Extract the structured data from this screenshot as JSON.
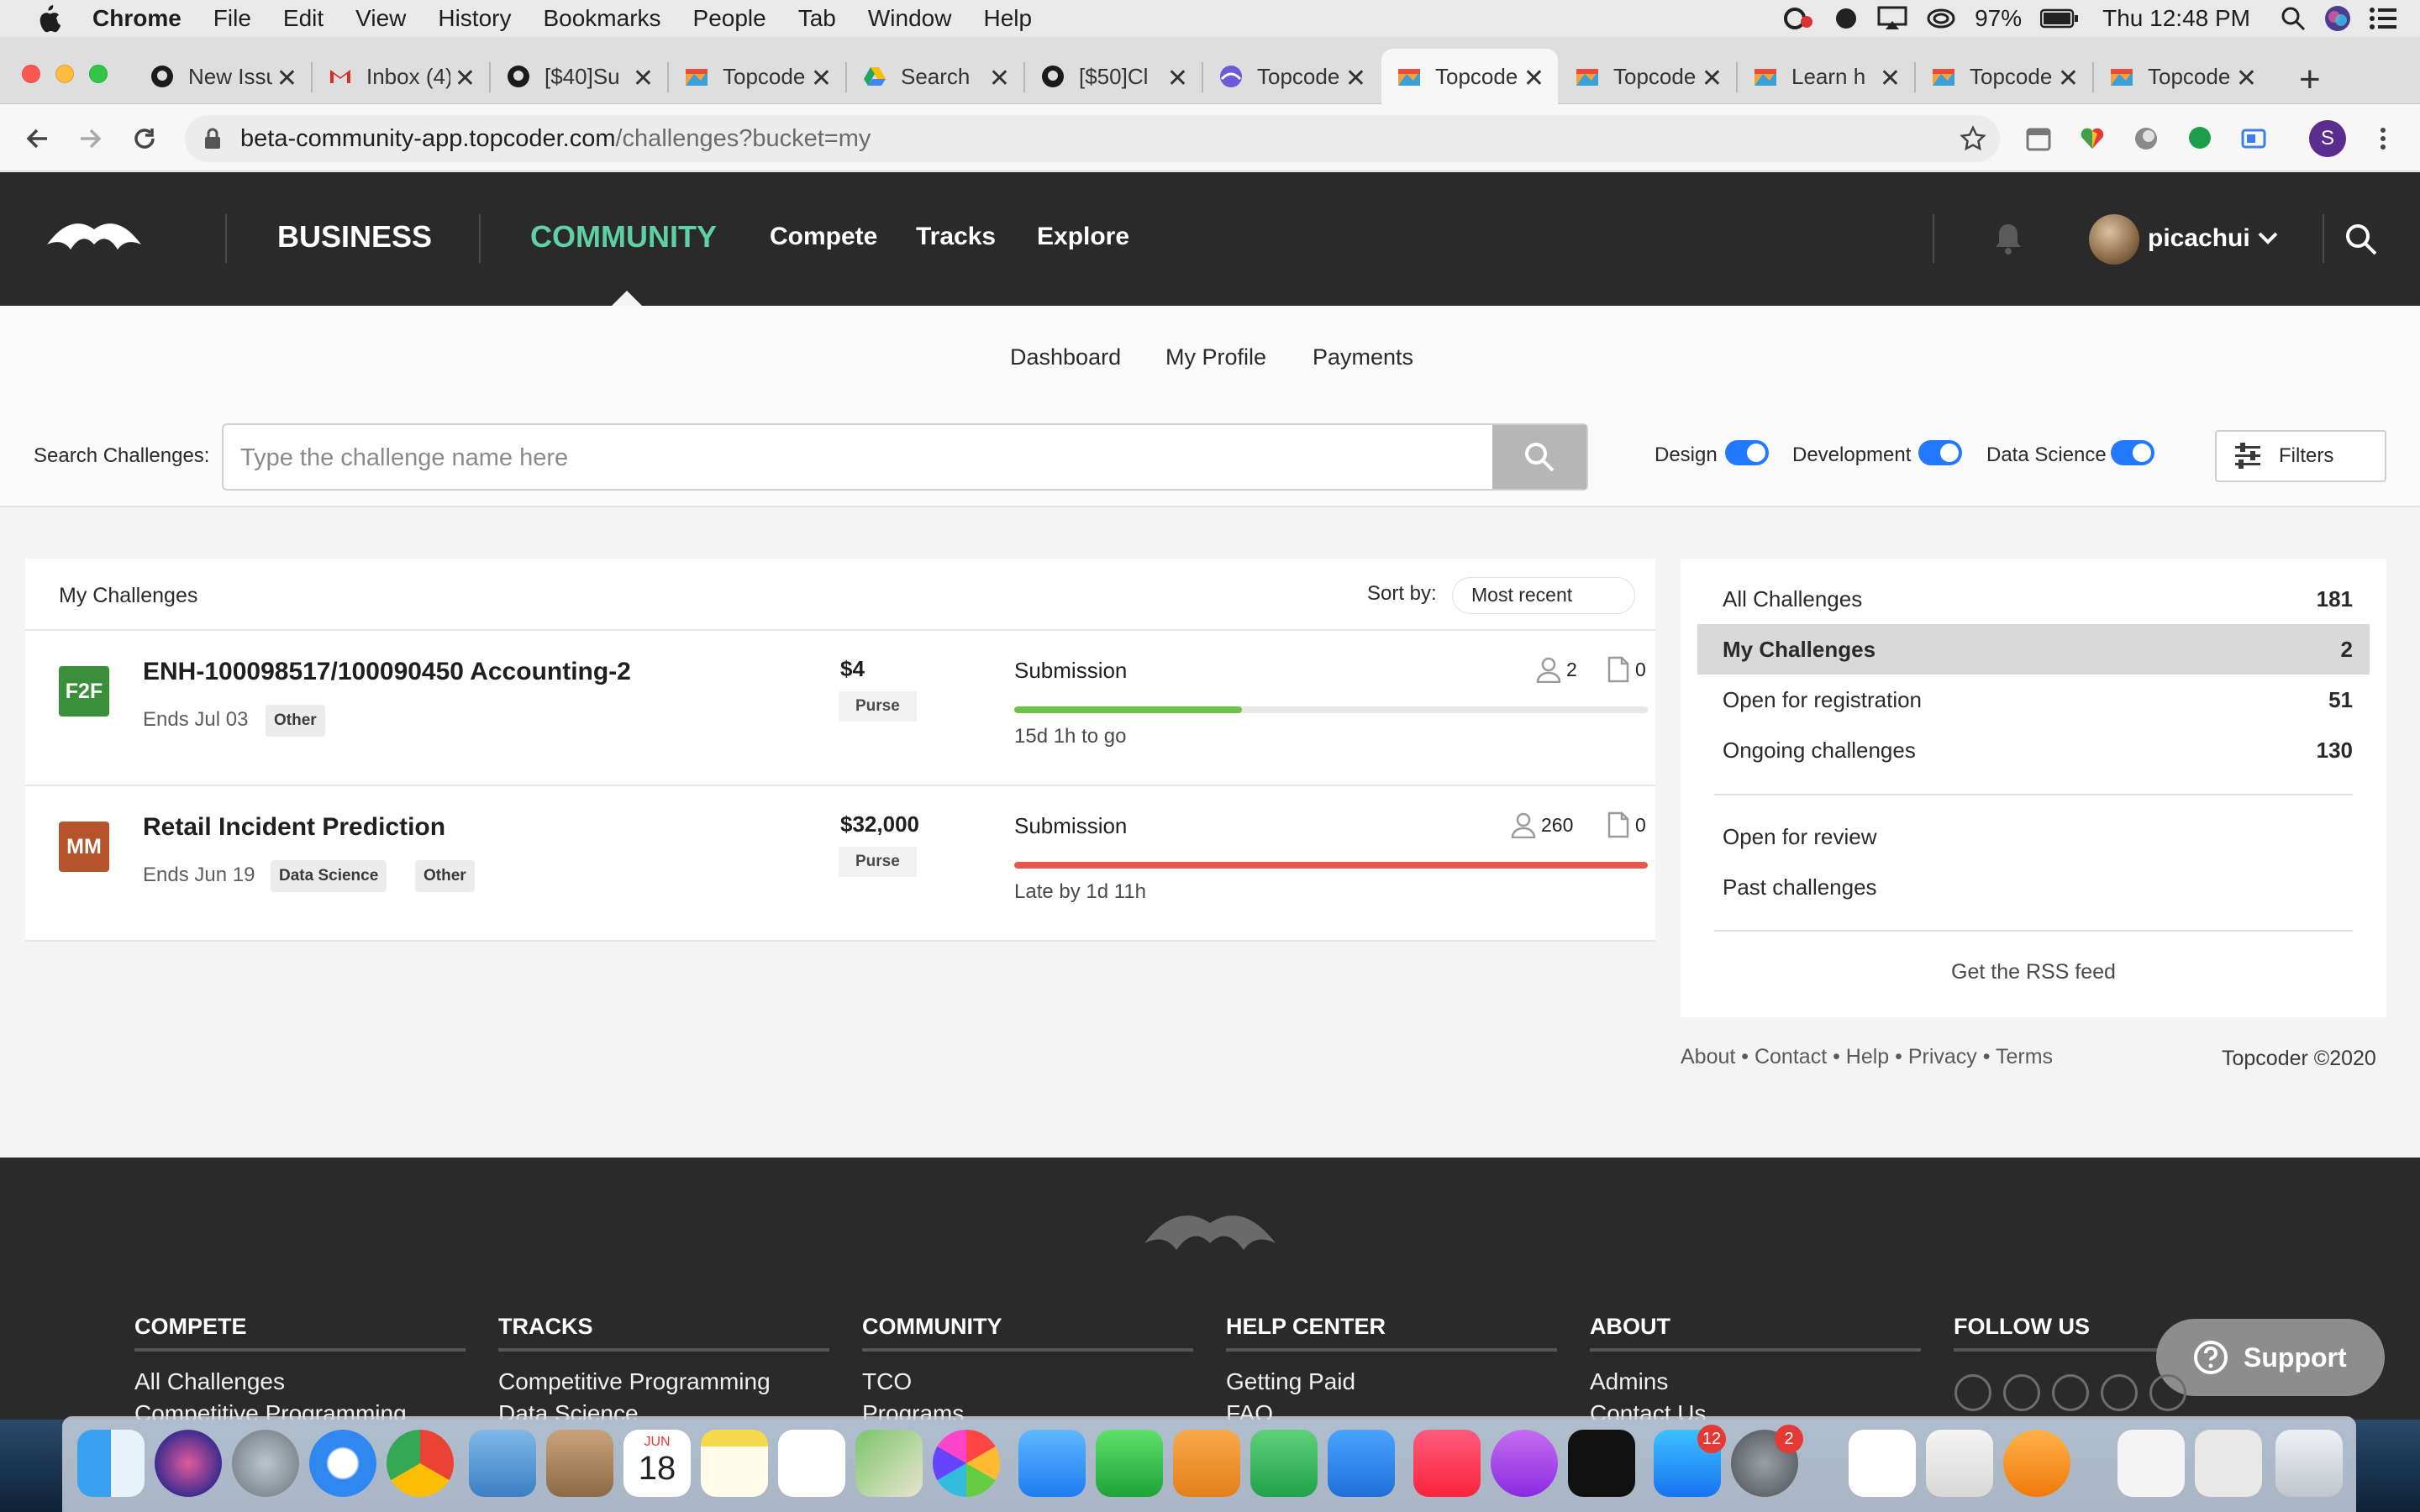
{
  "menubar": {
    "app_name": "Chrome",
    "items": [
      "File",
      "Edit",
      "View",
      "History",
      "Bookmarks",
      "People",
      "Tab",
      "Window",
      "Help"
    ],
    "battery": "97%",
    "clock": "Thu 12:48 PM"
  },
  "tabs": [
    {
      "label": "New Issue",
      "icon": "github-icon"
    },
    {
      "label": "Inbox (4)",
      "icon": "gmail-icon"
    },
    {
      "label": "[$40]Su",
      "icon": "github-icon"
    },
    {
      "label": "Topcoder",
      "icon": "topcoder-icon"
    },
    {
      "label": "Search",
      "icon": "drive-icon"
    },
    {
      "label": "[$50]Cl",
      "icon": "github-icon"
    },
    {
      "label": "Topcoder",
      "icon": "topcoder-blue-icon"
    },
    {
      "label": "Topcoder",
      "icon": "topcoder-icon",
      "active": true
    },
    {
      "label": "Topcoder",
      "icon": "topcoder-icon"
    },
    {
      "label": "Learn h",
      "icon": "topcoder-icon"
    },
    {
      "label": "Topcoder",
      "icon": "topcoder-icon"
    },
    {
      "label": "Topcoder",
      "icon": "topcoder-icon"
    }
  ],
  "address": {
    "host": "beta-community-app.topcoder.com",
    "path": "/challenges?bucket=my"
  },
  "header": {
    "business": "BUSINESS",
    "community": "COMMUNITY",
    "nav": [
      "Compete",
      "Tracks",
      "Explore"
    ],
    "username": "picachui"
  },
  "subnav": [
    "Dashboard",
    "My Profile",
    "Payments"
  ],
  "search": {
    "label": "Search Challenges:",
    "placeholder": "Type the challenge name here"
  },
  "toggles": [
    {
      "label": "Design",
      "on": true
    },
    {
      "label": "Development",
      "on": true
    },
    {
      "label": "Data Science",
      "on": true
    }
  ],
  "filters_label": "Filters",
  "list": {
    "title": "My Challenges",
    "sort_label": "Sort by:",
    "sort_value": "Most recent",
    "challenges": [
      {
        "track": "F2F",
        "track_color": "#3b8f3b",
        "title": "ENH-100098517/100090450 Accounting-2",
        "ends": "Ends Jul 03",
        "tags": [
          "Other"
        ],
        "prize": "$4",
        "purse": "Purse",
        "phase": "Submission",
        "progress": 0.36,
        "progress_color": "#6cc24a",
        "time": "15d 1h to go",
        "registrants": "2",
        "submissions": "0"
      },
      {
        "track": "MM",
        "track_color": "#b5532a",
        "title": "Retail Incident Prediction",
        "ends": "Ends Jun 19",
        "tags": [
          "Data Science",
          "Other"
        ],
        "prize": "$32,000",
        "purse": "Purse",
        "phase": "Submission",
        "progress": 1.0,
        "progress_color": "#e5594a",
        "time": "Late by 1d 11h",
        "registrants": "260",
        "submissions": "0"
      }
    ]
  },
  "buckets": {
    "main": [
      {
        "label": "All Challenges",
        "count": "181"
      },
      {
        "label": "My Challenges",
        "count": "2",
        "selected": true
      },
      {
        "label": "Open for registration",
        "count": "51"
      },
      {
        "label": "Ongoing challenges",
        "count": "130"
      }
    ],
    "extra": [
      "Open for review",
      "Past challenges"
    ],
    "rss": "Get the RSS feed"
  },
  "footer_links": "About • Contact • Help • Privacy • Terms",
  "copyright": "Topcoder ©2020",
  "footer": {
    "columns": [
      {
        "heading": "COMPETE",
        "links": [
          "All Challenges",
          "Competitive Programming"
        ]
      },
      {
        "heading": "TRACKS",
        "links": [
          "Competitive Programming",
          "Data Science"
        ]
      },
      {
        "heading": "COMMUNITY",
        "links": [
          "TCO",
          "Programs"
        ]
      },
      {
        "heading": "HELP CENTER",
        "links": [
          "Getting Paid",
          "FAQ"
        ]
      },
      {
        "heading": "ABOUT",
        "links": [
          "Admins",
          "Contact Us"
        ]
      },
      {
        "heading": "FOLLOW US",
        "links": []
      }
    ],
    "social": [
      "facebook-icon",
      "youtube-icon",
      "linkedin-icon",
      "twitter-icon",
      "instagram-icon"
    ],
    "support": "Support"
  },
  "dock": {
    "calendar_month": "JUN",
    "calendar_day": "18",
    "appstore_badge": "12",
    "settings_badge": "2"
  }
}
